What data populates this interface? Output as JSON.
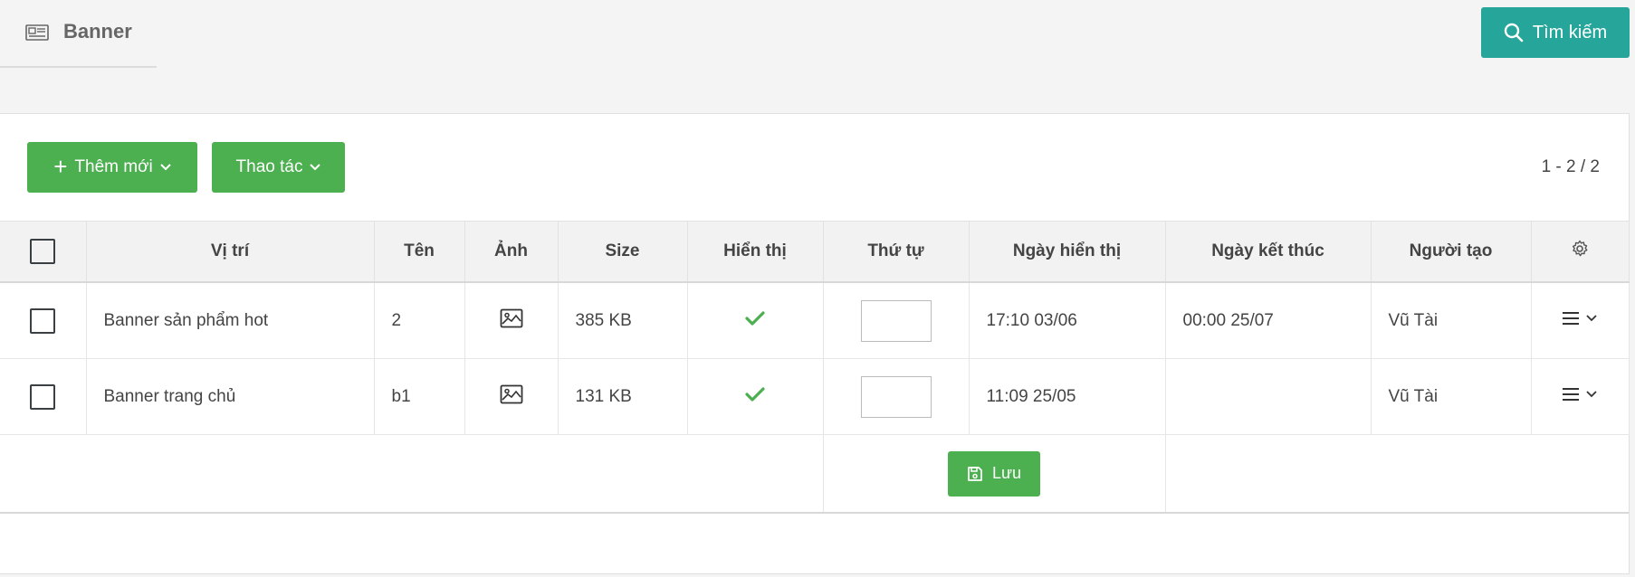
{
  "page": {
    "title": "Banner",
    "title_icon": "newspaper-icon"
  },
  "header": {
    "search_label": "Tìm kiếm"
  },
  "toolbar": {
    "add_label": "Thêm mới",
    "ops_label": "Thao tác",
    "pagination": "1 - 2 / 2"
  },
  "table": {
    "columns": {
      "position": "Vị trí",
      "name": "Tên",
      "image": "Ảnh",
      "size": "Size",
      "visible": "Hiển thị",
      "order": "Thứ tự",
      "start_date": "Ngày hiển thị",
      "end_date": "Ngày kết thúc",
      "creator": "Người tạo"
    },
    "rows": [
      {
        "position": "Banner sản phẩm hot",
        "name": "2",
        "size": "385 KB",
        "visible": true,
        "order": "",
        "start_date": "17:10 03/06",
        "end_date": "00:00 25/07",
        "creator": "Vũ Tài"
      },
      {
        "position": "Banner trang chủ",
        "name": "b1",
        "size": "131 KB",
        "visible": true,
        "order": "",
        "start_date": "11:09 25/05",
        "end_date": "",
        "creator": "Vũ Tài"
      }
    ],
    "save_label": "Lưu"
  },
  "colors": {
    "primary_green": "#4caf50",
    "teal": "#26a69a",
    "check_green": "#4caf50"
  }
}
